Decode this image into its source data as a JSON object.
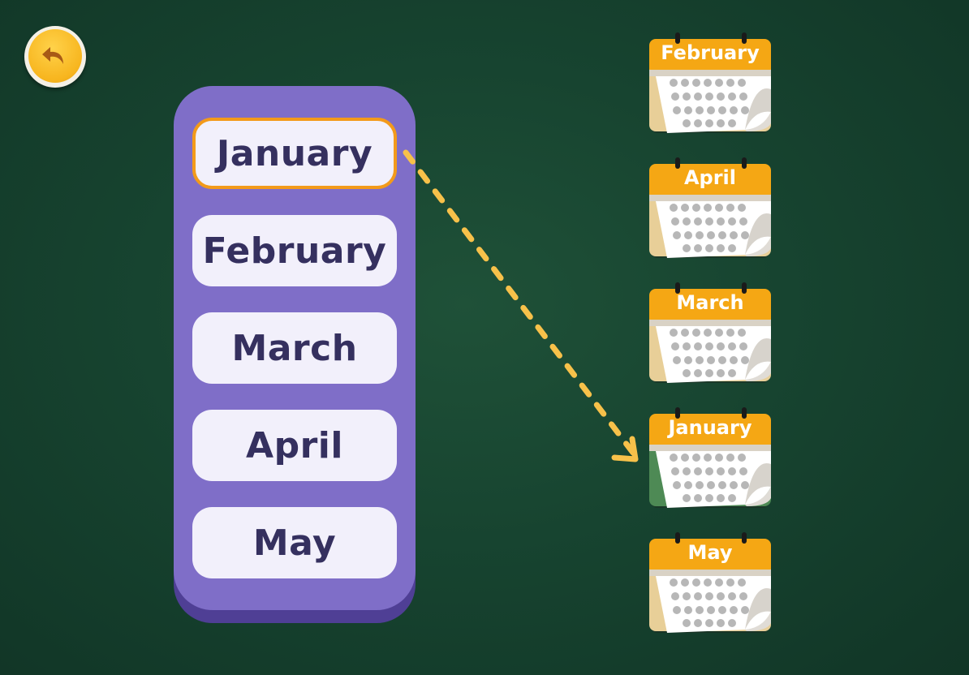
{
  "back_button": {
    "icon": "undo-arrow-icon"
  },
  "months_list": [
    {
      "label": "January",
      "selected": true
    },
    {
      "label": "February",
      "selected": false
    },
    {
      "label": "March",
      "selected": false
    },
    {
      "label": "April",
      "selected": false
    },
    {
      "label": "May",
      "selected": false
    }
  ],
  "calendars": [
    {
      "label": "February",
      "matched": false
    },
    {
      "label": "April",
      "matched": false
    },
    {
      "label": "March",
      "matched": false
    },
    {
      "label": "January",
      "matched": true
    },
    {
      "label": "May",
      "matched": false
    }
  ],
  "connection": {
    "from": "January",
    "to": "January",
    "style": "dashed-arrow"
  },
  "colors": {
    "panel": "#7f6ec8",
    "button_text": "#35305f",
    "selected_border": "#f39a1a",
    "calendar_header": "#f5a714",
    "calendar_matched_page": "#4e8a55",
    "arrow": "#f7c14a"
  }
}
